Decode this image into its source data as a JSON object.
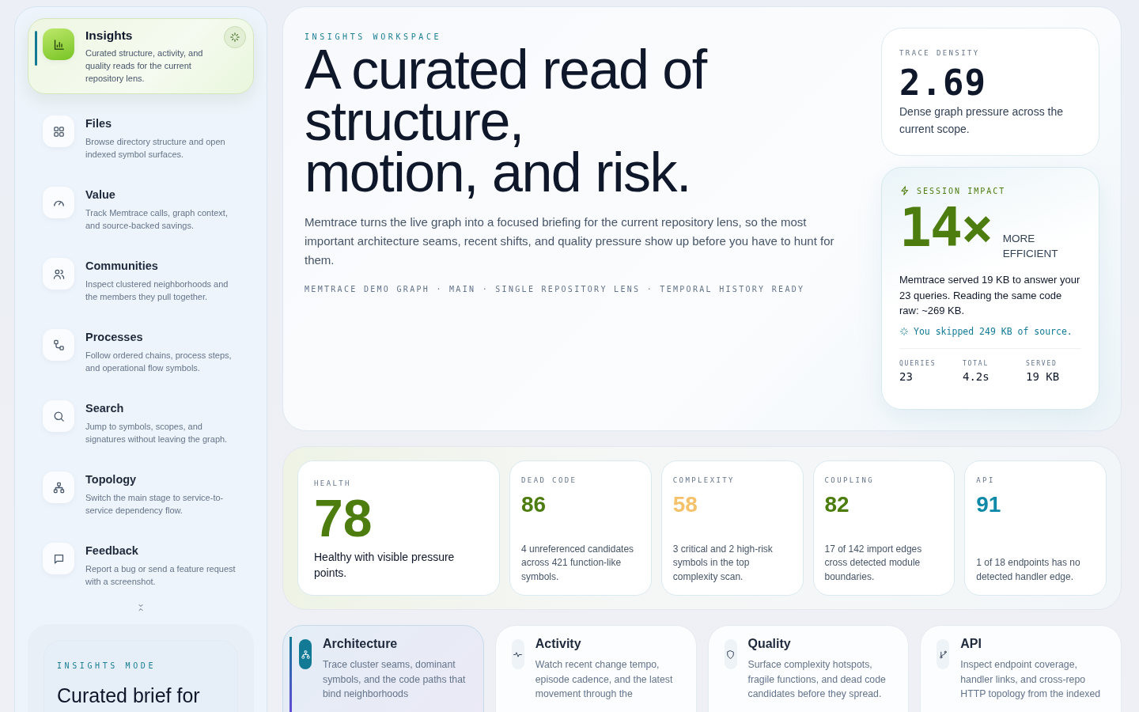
{
  "sidebar": {
    "items": [
      {
        "title": "Insights",
        "description": "Curated structure, activity, and quality reads for the current repository lens.",
        "selected": true
      },
      {
        "title": "Files",
        "description": "Browse directory structure and open indexed symbol surfaces.",
        "selected": false
      },
      {
        "title": "Value",
        "description": "Track Memtrace calls, graph context, and source-backed savings.",
        "selected": false
      },
      {
        "title": "Communities",
        "description": "Inspect clustered neighborhoods and the members they pull together.",
        "selected": false
      },
      {
        "title": "Processes",
        "description": "Follow ordered chains, process steps, and operational flow symbols.",
        "selected": false
      },
      {
        "title": "Search",
        "description": "Jump to symbols, scopes, and signatures without leaving the graph.",
        "selected": false
      },
      {
        "title": "Topology",
        "description": "Switch the main stage to service-to-service dependency flow.",
        "selected": false
      },
      {
        "title": "Feedback",
        "description": "Report a bug or send a feature request with a screenshot.",
        "selected": false
      }
    ],
    "mode": {
      "eyebrow": "INSIGHTS MODE",
      "title": "Curated brief for"
    }
  },
  "hero": {
    "eyebrow": "INSIGHTS WORKSPACE",
    "headline": "A curated read of\nstructure,\nmotion, and risk.",
    "body": "Memtrace turns the live graph into a focused briefing for the current repository lens, so the most important architecture seams, recent shifts, and quality pressure show up before you have to hunt for them.",
    "meta": "MEMTRACE DEMO GRAPH · MAIN · SINGLE REPOSITORY LENS · TEMPORAL HISTORY READY"
  },
  "trace_density": {
    "label": "TRACE DENSITY",
    "value": "2.69",
    "note": "Dense graph pressure across the current scope."
  },
  "session_impact": {
    "label": "SESSION IMPACT",
    "value": "14×",
    "unit": "MORE EFFICIENT",
    "summary": "Memtrace served 19 KB to answer your 23 queries. Reading the same code raw: ~269 KB.",
    "skipped": "You skipped 249 KB of source.",
    "stats": [
      {
        "label": "QUERIES",
        "value": "23"
      },
      {
        "label": "TOTAL",
        "value": "4.2s"
      },
      {
        "label": "SERVED",
        "value": "19 KB"
      }
    ]
  },
  "metrics": [
    {
      "label": "HEALTH",
      "value": "78",
      "note": "Healthy with visible pressure points.",
      "color": "#4d7c0f"
    },
    {
      "label": "DEAD CODE",
      "value": "86",
      "note": "4 unreferenced candidates across 421 function-like symbols.",
      "color": "#4d7c0f"
    },
    {
      "label": "COMPLEXITY",
      "value": "58",
      "note": "3 critical and 2 high-risk symbols in the top complexity scan.",
      "color": "#f5c26b"
    },
    {
      "label": "COUPLING",
      "value": "82",
      "note": "17 of 142 import edges cross detected module boundaries.",
      "color": "#4d7c0f"
    },
    {
      "label": "API",
      "value": "91",
      "note": "1 of 18 endpoints has no detected handler edge.",
      "color": "#0e8aa8"
    }
  ],
  "lenses": [
    {
      "title": "Architecture",
      "description": "Trace cluster seams, dominant symbols, and the code paths that bind neighborhoods",
      "selected": true
    },
    {
      "title": "Activity",
      "description": "Watch recent change tempo, episode cadence, and the latest movement through the",
      "selected": false
    },
    {
      "title": "Quality",
      "description": "Surface complexity hotspots, fragile functions, and dead code candidates before they spread.",
      "selected": false
    },
    {
      "title": "API",
      "description": "Inspect endpoint coverage, handler links, and cross-repo HTTP topology from the indexed",
      "selected": false
    }
  ]
}
